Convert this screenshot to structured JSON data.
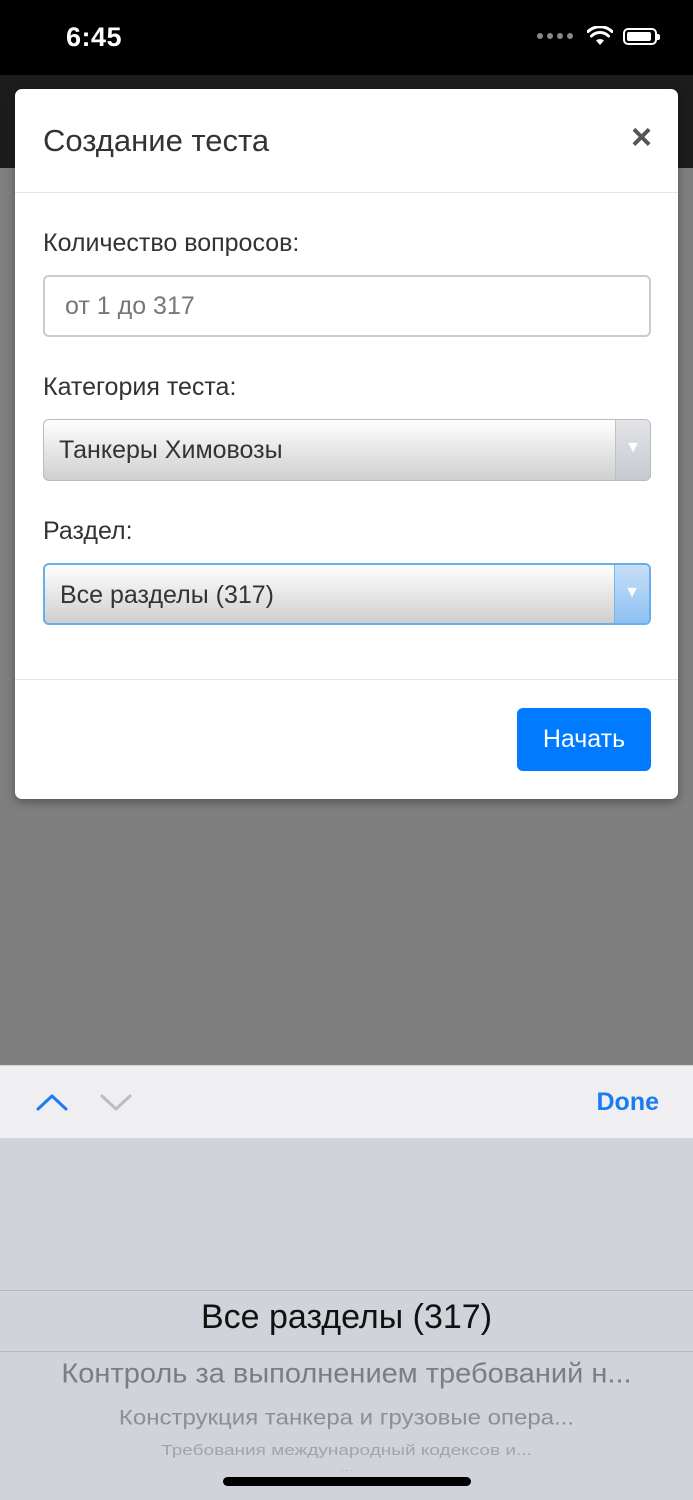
{
  "status_bar": {
    "time": "6:45"
  },
  "modal": {
    "title": "Создание теста",
    "close_symbol": "×",
    "question_count": {
      "label": "Количество вопросов:",
      "placeholder": "от 1 до 317",
      "value": ""
    },
    "category": {
      "label": "Категория теста:",
      "selected": "Танкеры Химовозы"
    },
    "section": {
      "label": "Раздел:",
      "selected": "Все разделы (317)"
    },
    "start_button": "Начать"
  },
  "picker_toolbar": {
    "done_label": "Done",
    "up_icon": "chevron-up-icon",
    "down_icon": "chevron-down-icon"
  },
  "picker": {
    "selected": "Все разделы (317)",
    "options": [
      "Контроль за выполнением требований н...",
      "Конструкция танкера и грузовые опера...",
      "Требования международный кодексов и...",
      "..."
    ]
  },
  "colors": {
    "primary": "#007bff",
    "ios_blue": "#1a7cf0",
    "overlay": "#7f7f7f",
    "focus": "#66afe9"
  }
}
